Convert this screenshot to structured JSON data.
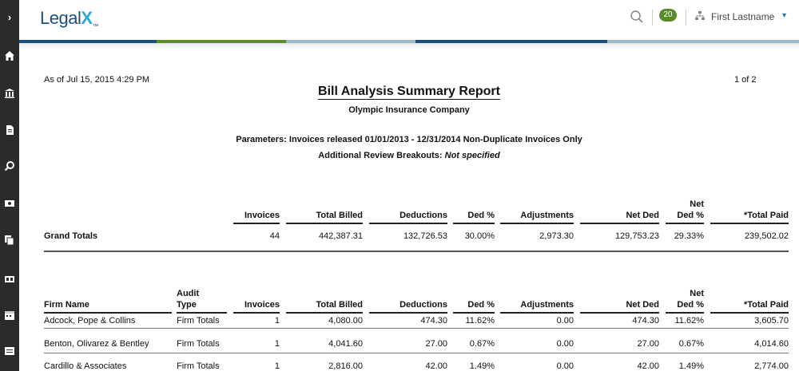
{
  "sidebar": {
    "toggle": "›",
    "icons": [
      "home-icon",
      "bank-icon",
      "document-icon",
      "search-doc-icon",
      "money-icon",
      "copy-icon",
      "card-icon",
      "calendar-icon",
      "table-icon"
    ]
  },
  "header": {
    "logo_text": "Legal",
    "logo_x": "X",
    "logo_tm": "™",
    "notification_count": "20",
    "user_name": "First Lastname",
    "caret": "▾"
  },
  "colors": {
    "sidebar": "#2b2b2b",
    "brand_blue": "#1d4f7a",
    "accent_green": "#5b8c2a",
    "bar_segments": [
      "#1d4f7a",
      "#5b8c2a",
      "#9fb8c8",
      "#1d4f7a",
      "#9fb8c8"
    ]
  },
  "report": {
    "as_of": "As of Jul 15, 2015 4:29 PM",
    "page_of": "1 of 2",
    "title": "Bill Analysis Summary Report",
    "company": "Olympic Insurance Company",
    "parameters": "Parameters: Invoices released 01/01/2013 - 12/31/2014 Non-Duplicate Invoices Only",
    "breakouts_label": "Additional Review Breakouts:",
    "breakouts_value": "Not specified",
    "grand_headers": {
      "invoices": "Invoices",
      "total_billed": "Total Billed",
      "deductions": "Deductions",
      "ded_pct": "Ded %",
      "adjustments": "Adjustments",
      "net_ded": "Net Ded",
      "net_ded_pct_1": "Net",
      "net_ded_pct_2": "Ded %",
      "total_paid": "*Total Paid"
    },
    "grand_totals": {
      "label": "Grand Totals",
      "invoices": "44",
      "total_billed": "442,387.31",
      "deductions": "132,726.53",
      "ded_pct": "30.00%",
      "adjustments": "2,973.30",
      "net_ded": "129,753.23",
      "net_ded_pct": "29.33%",
      "total_paid": "239,502.02"
    },
    "firm_headers": {
      "firm_name": "Firm Name",
      "audit_type_1": "Audit",
      "audit_type_2": "Type",
      "invoices": "Invoices",
      "total_billed": "Total Billed",
      "deductions": "Deductions",
      "ded_pct": "Ded %",
      "adjustments": "Adjustments",
      "net_ded": "Net Ded",
      "net_ded_pct_1": "Net",
      "net_ded_pct_2": "Ded %",
      "total_paid": "*Total Paid"
    },
    "firms": [
      {
        "name": "Adcock, Pope & Collins",
        "audit_type": "Firm Totals",
        "invoices": "1",
        "total_billed": "4,080.00",
        "deductions": "474.30",
        "ded_pct": "11.62%",
        "adjustments": "0.00",
        "net_ded": "474.30",
        "net_ded_pct": "11.62%",
        "total_paid": "3,605.70"
      },
      {
        "name": "Benton, Olivarez & Bentley",
        "audit_type": "Firm Totals",
        "invoices": "1",
        "total_billed": "4,041.60",
        "deductions": "27.00",
        "ded_pct": "0.67%",
        "adjustments": "0.00",
        "net_ded": "27.00",
        "net_ded_pct": "0.67%",
        "total_paid": "4,014.60"
      },
      {
        "name": "Cardillo & Associates",
        "audit_type": "Firm Totals",
        "invoices": "1",
        "total_billed": "2,816.00",
        "deductions": "42.00",
        "ded_pct": "1.49%",
        "adjustments": "0.00",
        "net_ded": "42.00",
        "net_ded_pct": "1.49%",
        "total_paid": "2,774.00"
      }
    ]
  }
}
